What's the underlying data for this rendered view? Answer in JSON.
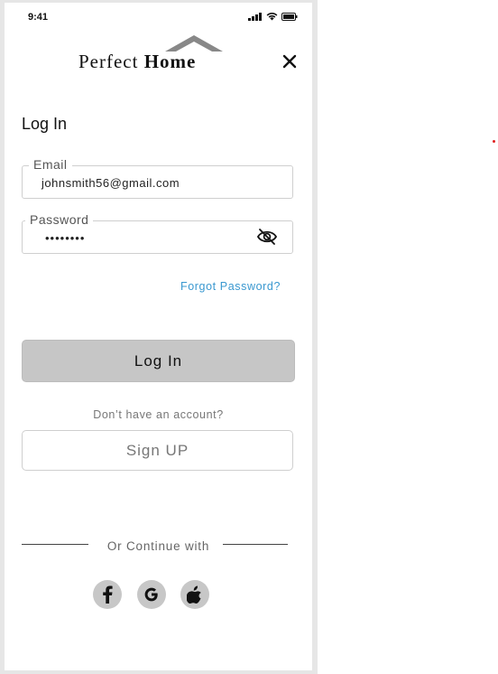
{
  "status_bar": {
    "time": "9:41"
  },
  "brand": {
    "word1": "Perfect",
    "word2": "Home"
  },
  "page": {
    "title": "Log In"
  },
  "email": {
    "label": "Email",
    "value": "johnsmith56@gmail.com"
  },
  "password": {
    "label": "Password",
    "masked_value": "••••••••"
  },
  "links": {
    "forgot_password": "Forgot Password?"
  },
  "actions": {
    "login_label": "Log In",
    "no_account_text": "Don’t have an account?",
    "signup_label": "Sign UP"
  },
  "social": {
    "divider_text": "Or Continue with",
    "providers": [
      "facebook",
      "google",
      "apple"
    ]
  },
  "colors": {
    "link": "#3a98d0",
    "login_button": "#c6c6c6",
    "social_circle": "#c7c7c7"
  }
}
